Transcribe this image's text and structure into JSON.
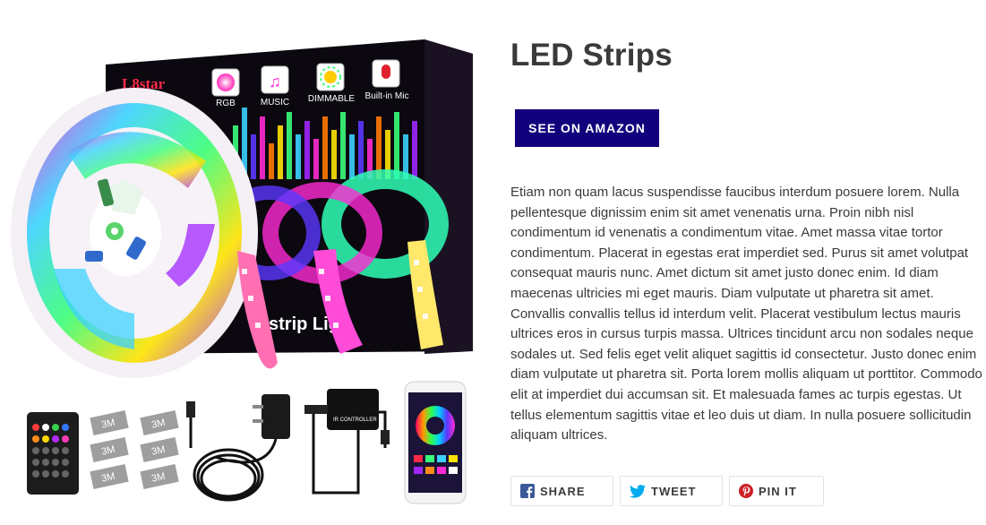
{
  "product": {
    "title": "LED Strips",
    "buy_button_label": "SEE ON AMAZON",
    "description": "Etiam non quam lacus suspendisse faucibus interdum posuere lorem. Nulla pellentesque dignissim enim sit amet venenatis urna. Proin nibh nisl condimentum id venenatis a condimentum vitae. Amet massa vitae tortor condimentum. Placerat in egestas erat imperdiet sed. Purus sit amet volutpat consequat mauris nunc. Amet dictum sit amet justo donec enim. Id diam maecenas ultricies mi eget mauris. Diam vulputate ut pharetra sit amet. Convallis convallis tellus id interdum velit. Placerat vestibulum lectus mauris ultrices eros in cursus turpis massa. Ultrices tincidunt arcu non sodales neque sodales ut. Sed felis eget velit aliquet sagittis id consectetur. Justo donec enim diam vulputate ut pharetra sit. Porta lorem mollis aliquam ut porttitor. Commodo elit at imperdiet dui accumsan sit. Et malesuada fames ac turpis egestas. Ut tellus elementum sagittis vitae et leo duis ut diam. In nulla posuere sollicitudin aliquam ultrices."
  },
  "image": {
    "brand": "L8star",
    "features": [
      "RGB",
      "MUSIC",
      "DIMMABLE",
      "Built-in Mic"
    ],
    "box_text": "strip Lig",
    "tape_label": "3M",
    "controller_label": "IR CONTROLLER"
  },
  "share": {
    "facebook_label": "SHARE",
    "twitter_label": "TWEET",
    "pinterest_label": "PIN IT"
  },
  "colors": {
    "button_bg": "#12007c",
    "facebook": "#3b5998",
    "twitter": "#00aced",
    "pinterest": "#cb2027",
    "text": "#3a3a3a"
  }
}
